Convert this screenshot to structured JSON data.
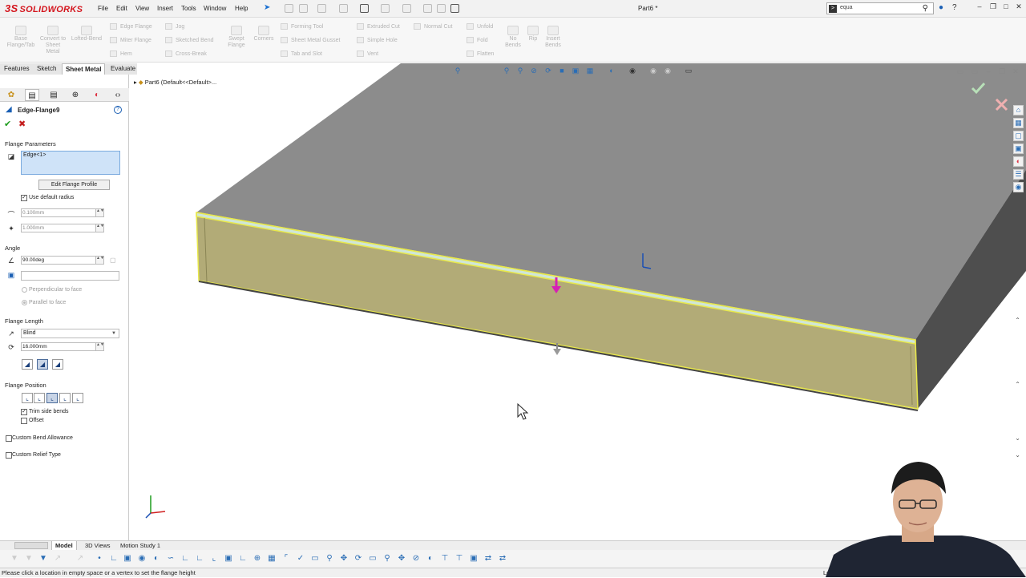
{
  "app": {
    "logo": "SOLIDWORKS",
    "logo_mark": "3S"
  },
  "menu": [
    "File",
    "Edit",
    "View",
    "Insert",
    "Tools",
    "Window",
    "Help"
  ],
  "document_title": "Part6 *",
  "search": {
    "value": "equa"
  },
  "ribbon": {
    "big_buttons": [
      {
        "label": "Base Flange/Tab",
        "icon": "base-flange-icon"
      },
      {
        "label": "Convert to Sheet Metal",
        "icon": "convert-sheet-metal-icon"
      },
      {
        "label": "Lofted-Bend",
        "icon": "lofted-bend-icon"
      },
      {
        "label": "Swept Flange",
        "icon": "swept-flange-icon"
      },
      {
        "label": "Corners",
        "icon": "corners-icon"
      },
      {
        "label": "No Bends",
        "icon": "no-bends-icon"
      },
      {
        "label": "Rip",
        "icon": "rip-icon"
      },
      {
        "label": "Insert Bends",
        "icon": "insert-bends-icon"
      }
    ],
    "small_buttons": [
      "Edge Flange",
      "Jog",
      "Miter Flange",
      "Sketched Bend",
      "Hem",
      "Cross-Break",
      "Forming Tool",
      "Sheet Metal Gusset",
      "Tab and Slot",
      "Extruded Cut",
      "Normal Cut",
      "Simple Hole",
      "Vent",
      "Unfold",
      "Fold",
      "Flatten"
    ]
  },
  "command_tabs": [
    "Features",
    "Sketch",
    "Sheet Metal",
    "Evaluate"
  ],
  "active_command_tab": "Sheet Metal",
  "property_manager": {
    "title": "Edge-Flange9",
    "flange_parameters": {
      "header": "Flange Parameters",
      "selection": "Edge<1>",
      "edit_profile_button": "Edit Flange Profile",
      "use_default_radius": "Use default radius",
      "use_default_radius_checked": true,
      "radius": "0.100mm",
      "gap": "1.000mm"
    },
    "angle": {
      "header": "Angle",
      "value": "90.00deg",
      "face_field": "",
      "perpendicular": "Perpendicular to face",
      "parallel": "Parallel to face"
    },
    "flange_length": {
      "header": "Flange Length",
      "end_condition": "Blind",
      "length": "16.000mm"
    },
    "flange_position": {
      "header": "Flange Position",
      "trim_side_bends": "Trim side bends",
      "trim_side_bends_checked": true,
      "offset": "Offset",
      "offset_checked": false
    },
    "custom_bend_allowance": "Custom Bend Allowance",
    "custom_relief_type": "Custom Relief Type"
  },
  "feature_tree": {
    "root": "Part6  (Default<<Default>..."
  },
  "bottom_tabs": [
    "Model",
    "3D Views",
    "Motion Study 1"
  ],
  "active_bottom_tab": "Model",
  "status_bar": {
    "message": "Please click a location in empty space or a vertex to set the flange height",
    "right": "Lo"
  },
  "colors": {
    "brand": "#d4151d",
    "flange_fill": "#b2ab77",
    "flange_highlight": "#e8e84a",
    "part_top": "#8c8c8c",
    "selection_blue": "#cfe3f8"
  }
}
